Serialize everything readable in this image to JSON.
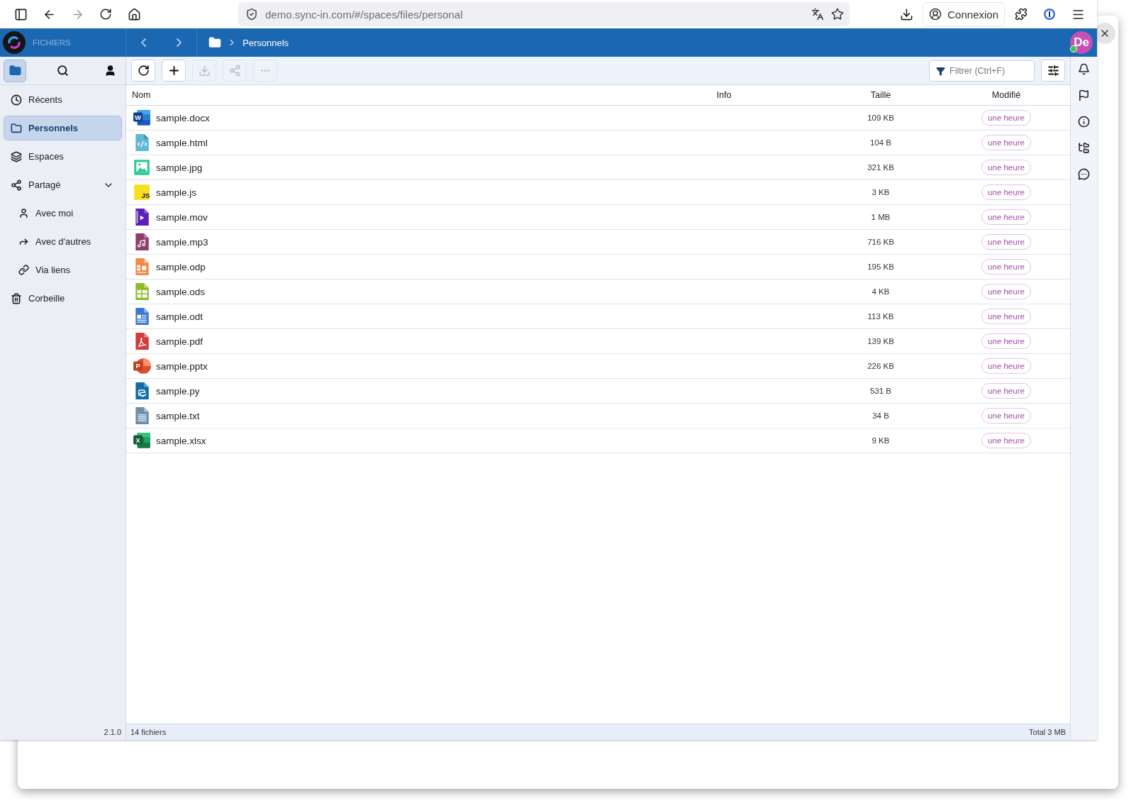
{
  "browser": {
    "url": "demo.sync-in.com/#/spaces/files/personal",
    "account_button": "Connexion"
  },
  "app": {
    "section": "FICHIERS",
    "breadcrumb": "Personnels",
    "avatar": "De",
    "online": true
  },
  "sidebar": {
    "tabs": [
      {
        "kind": "files",
        "selected": true
      },
      {
        "kind": "search",
        "selected": false
      },
      {
        "kind": "user",
        "selected": false
      }
    ],
    "items": [
      {
        "kind": "clock",
        "label": "Récents",
        "selected": false
      },
      {
        "kind": "folder",
        "label": "Personnels",
        "selected": true
      },
      {
        "kind": "layers",
        "label": "Espaces",
        "selected": false
      },
      {
        "kind": "share",
        "label": "Partagé",
        "selected": false,
        "expanded": true,
        "children": [
          {
            "kind": "user",
            "label": "Avec moi",
            "selected": false
          },
          {
            "kind": "forward",
            "label": "Avec d'autres",
            "selected": false
          },
          {
            "kind": "link",
            "label": "Via liens",
            "selected": false
          }
        ]
      },
      {
        "kind": "trash",
        "label": "Corbeille",
        "selected": false
      }
    ],
    "version": "2.1.0"
  },
  "toolbar": {
    "buttons": [
      {
        "kind": "reload",
        "disabled": false
      },
      {
        "kind": "add",
        "disabled": false
      },
      {
        "kind": "download",
        "disabled": true
      },
      {
        "kind": "share",
        "disabled": true
      },
      {
        "kind": "more",
        "disabled": true
      }
    ],
    "filter": {
      "placeholder": "Filtrer (Ctrl+F)"
    }
  },
  "table": {
    "columns": [
      "Nom",
      "Info",
      "Taille",
      "Modifié"
    ],
    "rows": [
      {
        "kind": "docx",
        "name": "sample.docx",
        "icon_letter": "W",
        "size": "109 KB",
        "modified": "une heure"
      },
      {
        "kind": "html",
        "name": "sample.html",
        "size": "104 B",
        "modified": "une heure"
      },
      {
        "kind": "jpg",
        "name": "sample.jpg",
        "size": "321 KB",
        "modified": "une heure"
      },
      {
        "kind": "js",
        "name": "sample.js",
        "icon_letter": "JS",
        "size": "3 KB",
        "modified": "une heure"
      },
      {
        "kind": "mov",
        "name": "sample.mov",
        "size": "1 MB",
        "modified": "une heure"
      },
      {
        "kind": "mp3",
        "name": "sample.mp3",
        "size": "716 KB",
        "modified": "une heure"
      },
      {
        "kind": "odp",
        "name": "sample.odp",
        "size": "195 KB",
        "modified": "une heure"
      },
      {
        "kind": "ods",
        "name": "sample.ods",
        "size": "4 KB",
        "modified": "une heure"
      },
      {
        "kind": "odt",
        "name": "sample.odt",
        "size": "113 KB",
        "modified": "une heure"
      },
      {
        "kind": "pdf",
        "name": "sample.pdf",
        "size": "139 KB",
        "modified": "une heure"
      },
      {
        "kind": "pptx",
        "name": "sample.pptx",
        "icon_letter": "P",
        "size": "226 KB",
        "modified": "une heure"
      },
      {
        "kind": "py",
        "name": "sample.py",
        "size": "531 B",
        "modified": "une heure"
      },
      {
        "kind": "txt",
        "name": "sample.txt",
        "size": "34 B",
        "modified": "une heure"
      },
      {
        "kind": "xlsx",
        "name": "sample.xlsx",
        "icon_letter": "X",
        "size": "9 KB",
        "modified": "une heure"
      }
    ]
  },
  "status_bar": {
    "count": "14 fichiers",
    "total": "Total 3 MB"
  },
  "right_rail": [
    {
      "kind": "bell"
    },
    {
      "kind": "flag"
    },
    {
      "kind": "info"
    },
    {
      "kind": "tree"
    },
    {
      "kind": "chat"
    }
  ]
}
